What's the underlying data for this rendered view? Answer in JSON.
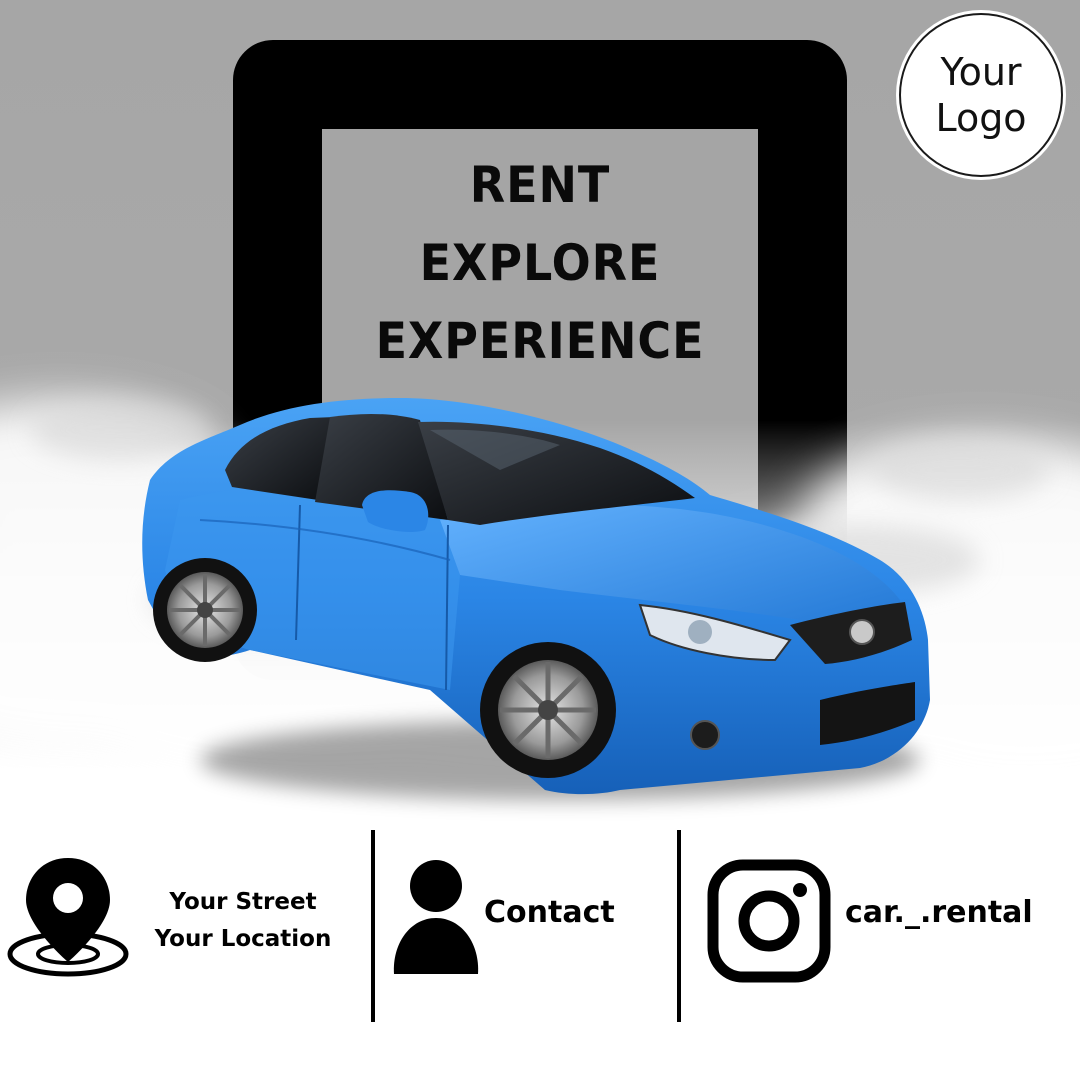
{
  "headline": {
    "lines": [
      "RENT",
      "EXPLORE",
      "EXPERIENCE"
    ]
  },
  "logo": {
    "lines": [
      "Your",
      "Logo"
    ]
  },
  "footer": {
    "address": {
      "icon": "location-pin-icon",
      "lines": [
        "Your Street",
        "Your Location"
      ]
    },
    "contact": {
      "icon": "person-icon",
      "label": "Contact"
    },
    "social": {
      "icon": "instagram-icon",
      "handle": "car._.rental"
    }
  },
  "colors": {
    "background": "#a6a6a6",
    "frame": "#000000",
    "car": "#2b86e6",
    "text": "#000000",
    "footer_background": "#ffffff"
  }
}
